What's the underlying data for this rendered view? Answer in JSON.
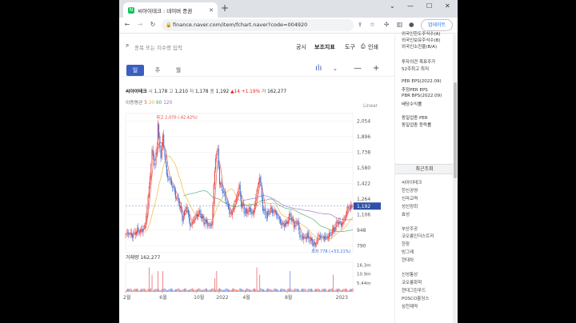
{
  "tab": {
    "title": "씨아이테크 : 네이버 증권",
    "favicon": "N"
  },
  "address": {
    "url": "finance.naver.com/item/fchart.naver?code=004920"
  },
  "toolbar": {
    "update_label": "업데이트"
  },
  "search": {
    "placeholder": "종목 또는 지수명 입력",
    "menu": [
      "공시",
      "보조지표",
      "도구",
      "인쇄"
    ]
  },
  "period_tabs": [
    "일",
    "주",
    "월"
  ],
  "stock": {
    "name": "씨아이테크",
    "open_label": "시",
    "open": "1,178",
    "high_label": "고",
    "high": "1,210",
    "low_label": "저",
    "low": "1,178",
    "close_label": "종",
    "close": "1,192",
    "change": "▲14",
    "change_pct": "+1.19%",
    "volume_label": "거",
    "volume": "162,277"
  },
  "ma": {
    "label": "이동평균",
    "periods": [
      "5",
      "20",
      "60",
      "120"
    ],
    "colors": [
      "#e34b4b",
      "#f0b12c",
      "#4aa867",
      "#9d6bc9"
    ]
  },
  "scale_label": "Linear",
  "right_panel": {
    "items_top": [
      "외국인한도주식수(A)",
      "외국인보유주식수(B)",
      "외국인소진율(B/A)"
    ],
    "items_mid": [
      "투자의견",
      "목표주가",
      "52주최고",
      "최저"
    ],
    "per": [
      "PER",
      "EPS(2022.09)",
      "추정PER",
      "EPS",
      "PBR",
      "BPS(2022.09)",
      "배당수익률"
    ],
    "industry": [
      "동일업종 PER",
      "동일업종 등락률"
    ],
    "recent_header": "최근조회",
    "recent": [
      "씨아이테크",
      "한신공영",
      "신라교역",
      "성신양회",
      "효성",
      "부산주공",
      "코오롱인더스트리",
      "한창",
      "빙그레",
      "현대차",
      "신성통상",
      "코오롱화학",
      "현대그린푸드",
      "POSCO홀딩스",
      "삼천제약"
    ]
  },
  "chart_data": {
    "type": "line",
    "title": "씨아이테크",
    "y_ticks": [
      "2,054",
      "1,896",
      "1,738",
      "1,580",
      "1,422",
      "1,264",
      "1,106",
      "948",
      "790"
    ],
    "y_tick_values": [
      2054,
      1896,
      1738,
      1580,
      1422,
      1264,
      1106,
      948,
      790
    ],
    "ylim": [
      720,
      2130
    ],
    "x_labels": [
      "2월",
      "6월",
      "10월",
      "2022",
      "4월",
      "8월",
      "2023"
    ],
    "x_label_index": [
      0,
      37,
      72,
      95,
      122,
      165,
      217
    ],
    "last_price_label": "1,192",
    "last_price": 1192,
    "max_annotation": "최고 2,070 (-42.42%)",
    "max_value": 2070,
    "max_index": 33,
    "min_annotation": "최저 778 (+53.21%)",
    "min_value": 778,
    "min_index": 193,
    "close_anchors": [
      [
        0,
        905
      ],
      [
        8,
        910
      ],
      [
        14,
        940
      ],
      [
        20,
        980
      ],
      [
        24,
        1400
      ],
      [
        27,
        1750
      ],
      [
        30,
        1580
      ],
      [
        33,
        1950
      ],
      [
        36,
        1700
      ],
      [
        38,
        1880
      ],
      [
        42,
        1520
      ],
      [
        48,
        1380
      ],
      [
        54,
        1240
      ],
      [
        58,
        1060
      ],
      [
        62,
        1200
      ],
      [
        66,
        980
      ],
      [
        70,
        1080
      ],
      [
        76,
        1120
      ],
      [
        80,
        1040
      ],
      [
        85,
        990
      ],
      [
        88,
        1020
      ],
      [
        90,
        1400
      ],
      [
        92,
        1680
      ],
      [
        94,
        1760
      ],
      [
        96,
        1440
      ],
      [
        100,
        1320
      ],
      [
        104,
        1200
      ],
      [
        108,
        1100
      ],
      [
        112,
        1240
      ],
      [
        116,
        1400
      ],
      [
        118,
        1200
      ],
      [
        122,
        1130
      ],
      [
        126,
        1160
      ],
      [
        130,
        1100
      ],
      [
        134,
        1350
      ],
      [
        137,
        1480
      ],
      [
        140,
        1180
      ],
      [
        144,
        1080
      ],
      [
        148,
        1160
      ],
      [
        152,
        1140
      ],
      [
        156,
        1060
      ],
      [
        160,
        1010
      ],
      [
        164,
        1000
      ],
      [
        168,
        1120
      ],
      [
        172,
        980
      ],
      [
        176,
        1040
      ],
      [
        178,
        880
      ],
      [
        182,
        860
      ],
      [
        186,
        900
      ],
      [
        190,
        820
      ],
      [
        193,
        800
      ],
      [
        197,
        900
      ],
      [
        200,
        860
      ],
      [
        204,
        890
      ],
      [
        208,
        880
      ],
      [
        212,
        960
      ],
      [
        216,
        1030
      ],
      [
        220,
        1000
      ],
      [
        224,
        1090
      ],
      [
        228,
        1180
      ],
      [
        232,
        1192
      ]
    ],
    "volume_label": "거래량",
    "volume_value": "162,277",
    "volume_ticks": [
      "16.3m",
      "10.9m",
      "5.44m"
    ],
    "volume_tick_values": [
      16.3,
      10.9,
      5.44
    ],
    "volume_max": 18,
    "n_points": 233
  }
}
